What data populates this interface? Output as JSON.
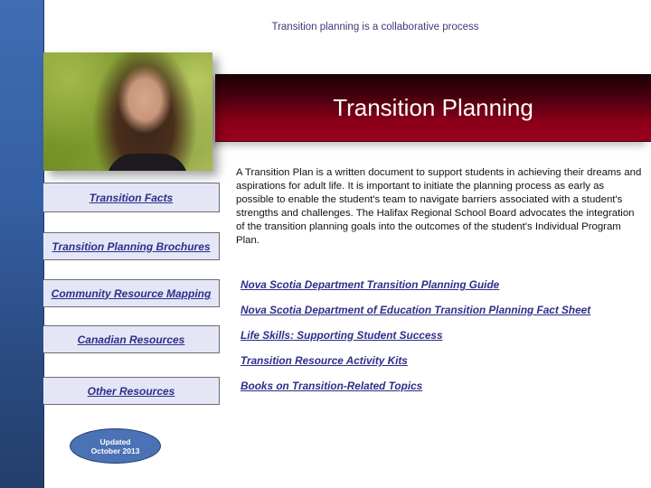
{
  "header": {
    "tagline": "Transition planning is a collaborative process",
    "title": "Transition Planning"
  },
  "photo": {
    "description": "student-portrait-photo"
  },
  "sidebar": {
    "items": [
      {
        "label": "Transition Facts"
      },
      {
        "label": "Transition Planning Brochures"
      },
      {
        "label": "Community Resource Mapping"
      },
      {
        "label": "Canadian Resources"
      },
      {
        "label": "Other Resources"
      }
    ]
  },
  "main": {
    "intro": "A Transition Plan is a written document to support students in achieving their dreams and aspirations for adult life.  It is important to initiate the planning process as early as possible to enable the student's team to navigate barriers associated with a student's strengths and challenges. The Halifax Regional School Board advocates the integration of the transition planning goals into the outcomes of the student's Individual Program Plan.",
    "links": [
      {
        "label": "Nova Scotia Department Transition Planning Guide"
      },
      {
        "label": "Nova Scotia Department of Education Transition Planning Fact Sheet"
      },
      {
        "label": "Life Skills: Supporting Student Success"
      },
      {
        "label": "Transition Resource Activity Kits"
      },
      {
        "label": "Books on Transition-Related Topics"
      }
    ]
  },
  "badge": {
    "line1": "Updated",
    "line2": "October 2013"
  },
  "colors": {
    "sidebar_blue": "#3560a3",
    "banner_red": "#9a001c",
    "link_color": "#2e2e8a",
    "button_bg": "#e4e6f6"
  }
}
